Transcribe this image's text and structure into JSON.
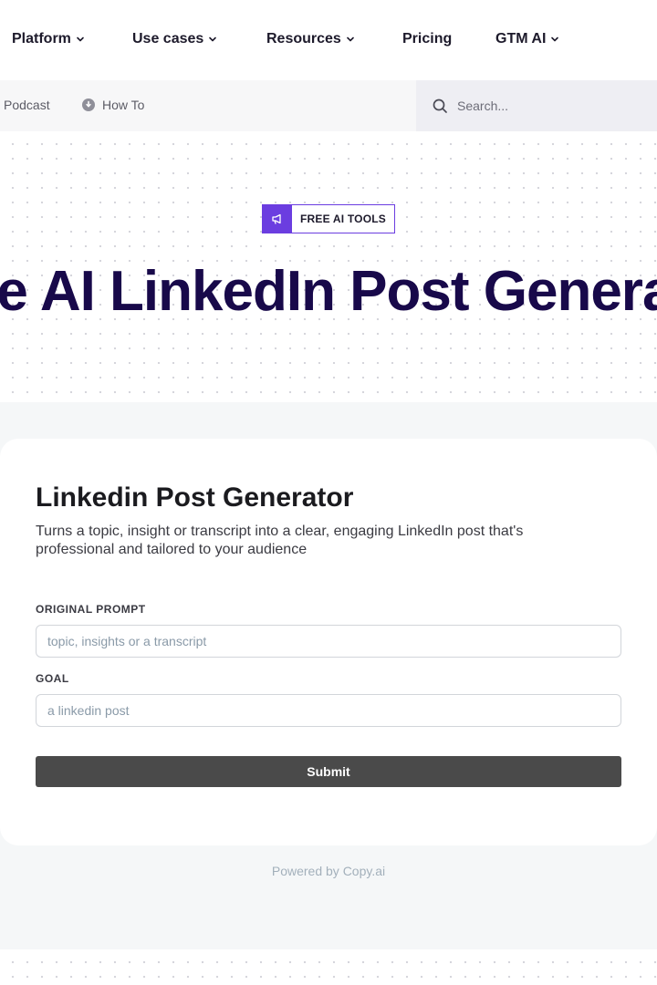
{
  "nav": {
    "items": [
      {
        "label": "Platform",
        "has_dropdown": true
      },
      {
        "label": "Use cases",
        "has_dropdown": true
      },
      {
        "label": "Resources",
        "has_dropdown": true
      },
      {
        "label": "Pricing",
        "has_dropdown": false
      },
      {
        "label": "GTM AI",
        "has_dropdown": true
      }
    ]
  },
  "subnav": {
    "links": [
      {
        "label": "Podcast"
      },
      {
        "label": "How To",
        "icon": "info-icon"
      }
    ],
    "search": {
      "placeholder": "Search...",
      "icon": "search-icon"
    }
  },
  "hero": {
    "badge": {
      "label": "FREE AI TOOLS",
      "icon": "megaphone-icon"
    },
    "title": "Free AI LinkedIn Post Generator"
  },
  "generator": {
    "title": "Linkedin Post Generator",
    "description": "Turns a topic, insight or transcript into a clear, engaging LinkedIn post that's professional and tailored to your audience",
    "fields": [
      {
        "label": "ORIGINAL PROMPT",
        "placeholder": "topic, insights or a transcript",
        "value": ""
      },
      {
        "label": "GOAL",
        "placeholder": "a linkedin post",
        "value": ""
      }
    ],
    "submit_label": "Submit"
  },
  "footer": {
    "powered_by": "Powered by Copy.ai"
  },
  "colors": {
    "accent": "#6b3de0",
    "hero_title": "#18094a",
    "submit_bg": "#4a4a4a",
    "section_bg": "#f5f7f8"
  }
}
